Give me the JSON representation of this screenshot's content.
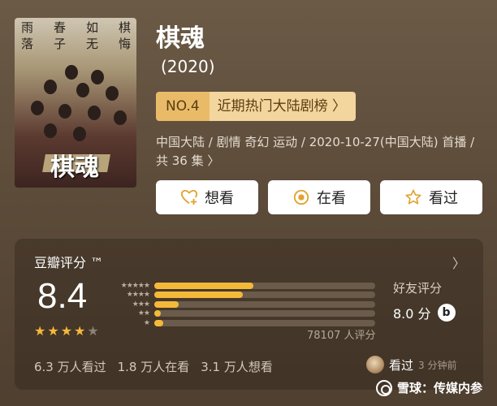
{
  "header": {
    "title": "棋魂",
    "year": "(2020)"
  },
  "poster": {
    "col1": "雨落",
    "col2": "春子",
    "col3": "如无",
    "col4": "棋悔",
    "logo": "棋魂"
  },
  "rank": {
    "no": "NO.4",
    "label": "近期热门大陆剧榜",
    "chevron": "〉"
  },
  "meta": {
    "text": "中国大陆 / 剧情 奇幻 运动 / 2020-10-27(中国大陆) 首播 / 共 36 集 〉"
  },
  "actions": {
    "want": "想看",
    "watching": "在看",
    "watched": "看过"
  },
  "rating": {
    "title": "豆瓣评分 ™",
    "chevron": "〉",
    "score": "8.4",
    "stars_filled": 4,
    "stars_total": 5,
    "distribution": [
      {
        "stars": "★★★★★",
        "percent": 45
      },
      {
        "stars": "★★★★",
        "percent": 40
      },
      {
        "stars": "★★★",
        "percent": 11
      },
      {
        "stars": "★★",
        "percent": 3
      },
      {
        "stars": "★",
        "percent": 4
      }
    ],
    "votes": "78107 人评分",
    "friends_title": "好友评分",
    "friends_score": "8.0 分",
    "friends_icon": "b"
  },
  "stats": {
    "watched": "6.3 万人看过",
    "watching": "1.8 万人在看",
    "want": "3.1 万人想看"
  },
  "recent": {
    "action": "看过",
    "time": "3 分钟前"
  },
  "watermark": {
    "text": "雪球：传媒内参"
  },
  "colors": {
    "accent": "#f5b93a",
    "rank_bg": "#f3d59e",
    "rank_no_bg": "#e9bb68"
  }
}
